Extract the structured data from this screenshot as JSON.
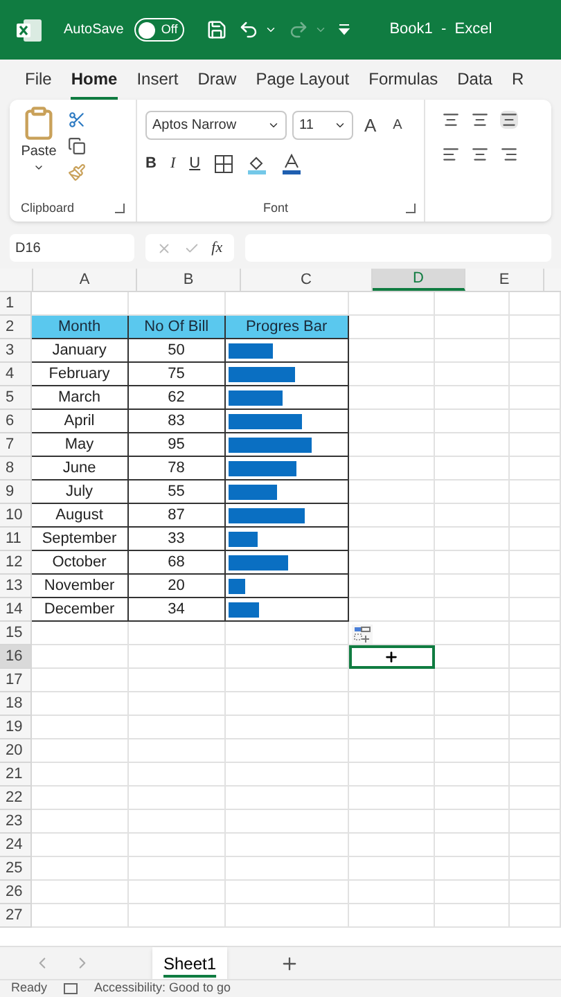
{
  "title_bar": {
    "autosave_label": "AutoSave",
    "autosave_toggle": {
      "on": false,
      "label": "Off"
    },
    "title": "Book1  -  Excel"
  },
  "menu_tabs": [
    {
      "label": "File",
      "selected": false
    },
    {
      "label": "Home",
      "selected": true
    },
    {
      "label": "Insert",
      "selected": false
    },
    {
      "label": "Draw",
      "selected": false
    },
    {
      "label": "Page Layout",
      "selected": false
    },
    {
      "label": "Formulas",
      "selected": false
    },
    {
      "label": "Data",
      "selected": false
    },
    {
      "label": "R",
      "selected": false
    }
  ],
  "ribbon": {
    "clipboard": {
      "paste_label": "Paste",
      "group_label": "Clipboard"
    },
    "font": {
      "font_name": "Aptos Narrow",
      "font_size": "11",
      "grow_font_label": "A",
      "shrink_font_label": "A",
      "bold_label": "B",
      "italic_label": "I",
      "underline_label": "U",
      "group_label": "Font"
    }
  },
  "formula_bar": {
    "name_box": "D16",
    "function_label": "fx"
  },
  "sheet": {
    "columns": [
      {
        "label": "A",
        "selected": false
      },
      {
        "label": "B",
        "selected": false
      },
      {
        "label": "C",
        "selected": false
      },
      {
        "label": "D",
        "selected": true
      },
      {
        "label": "E",
        "selected": false
      }
    ],
    "table": {
      "header": [
        "Month",
        "No Of Bill",
        "Progres Bar"
      ],
      "rows": [
        {
          "month": "January",
          "bills": "50",
          "level": 0.38
        },
        {
          "month": "February",
          "bills": "75",
          "level": 0.57
        },
        {
          "month": "March",
          "bills": "62",
          "level": 0.47
        },
        {
          "month": "April",
          "bills": "83",
          "level": 0.63
        },
        {
          "month": "May",
          "bills": "95",
          "level": 0.72
        },
        {
          "month": "June",
          "bills": "78",
          "level": 0.59
        },
        {
          "month": "July",
          "bills": "55",
          "level": 0.42
        },
        {
          "month": "August",
          "bills": "87",
          "level": 0.66
        },
        {
          "month": "September",
          "bills": "33",
          "level": 0.25
        },
        {
          "month": "October",
          "bills": "68",
          "level": 0.52
        },
        {
          "month": "November",
          "bills": "20",
          "level": 0.15
        },
        {
          "month": "December",
          "bills": "34",
          "level": 0.26
        }
      ]
    },
    "row_numbers": [
      {
        "label": "1",
        "selected": false
      },
      {
        "label": "2",
        "selected": false
      },
      {
        "label": "3",
        "selected": false
      },
      {
        "label": "4",
        "selected": false
      },
      {
        "label": "5",
        "selected": false
      },
      {
        "label": "6",
        "selected": false
      },
      {
        "label": "7",
        "selected": false
      },
      {
        "label": "8",
        "selected": false
      },
      {
        "label": "9",
        "selected": false
      },
      {
        "label": "10",
        "selected": false
      },
      {
        "label": "11",
        "selected": false
      },
      {
        "label": "12",
        "selected": false
      },
      {
        "label": "13",
        "selected": false
      },
      {
        "label": "14",
        "selected": false
      },
      {
        "label": "15",
        "selected": false
      },
      {
        "label": "16",
        "selected": true
      },
      {
        "label": "17",
        "selected": false
      },
      {
        "label": "18",
        "selected": false
      },
      {
        "label": "19",
        "selected": false
      },
      {
        "label": "20",
        "selected": false
      },
      {
        "label": "21",
        "selected": false
      },
      {
        "label": "22",
        "selected": false
      },
      {
        "label": "23",
        "selected": false
      },
      {
        "label": "24",
        "selected": false
      },
      {
        "label": "25",
        "selected": false
      },
      {
        "label": "26",
        "selected": false
      },
      {
        "label": "27",
        "selected": false
      }
    ]
  },
  "sheet_tabs": [
    {
      "label": "Sheet1",
      "selected": true
    }
  ],
  "status_bar": {
    "ready": "Ready",
    "accessibility": "Accessibility: Good to go"
  }
}
